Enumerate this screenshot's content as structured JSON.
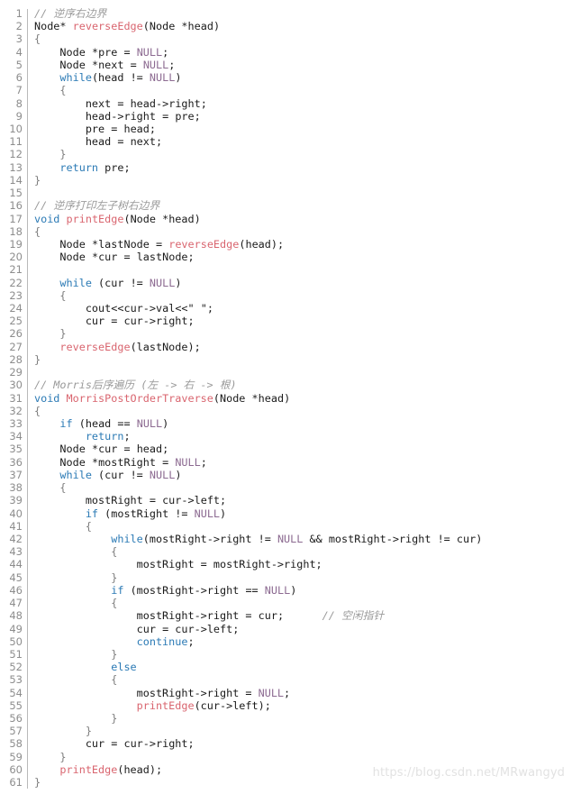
{
  "code_block": {
    "language": "cpp",
    "total_lines": 61,
    "theme": {
      "background": "#ffffff",
      "text": "#1a1a1a",
      "gutter_text": "#8d8d8d",
      "divider": "#b9b9b9",
      "keyword": "#2b7ab5",
      "function": "#d9656f",
      "constant": "#8c6a91",
      "comment": "#9a9a9a",
      "brace": "#7d7d7d",
      "watermark": "#e2e2e2"
    },
    "line_numbers": [
      "1",
      "2",
      "3",
      "4",
      "5",
      "6",
      "7",
      "8",
      "9",
      "10",
      "11",
      "12",
      "13",
      "14",
      "15",
      "16",
      "17",
      "18",
      "19",
      "20",
      "21",
      "22",
      "23",
      "24",
      "25",
      "26",
      "27",
      "28",
      "29",
      "30",
      "31",
      "32",
      "33",
      "34",
      "35",
      "36",
      "37",
      "38",
      "39",
      "40",
      "41",
      "42",
      "43",
      "44",
      "45",
      "46",
      "47",
      "48",
      "49",
      "50",
      "51",
      "52",
      "53",
      "54",
      "55",
      "56",
      "57",
      "58",
      "59",
      "60",
      "61"
    ],
    "lines": [
      "// 逆序右边界",
      "Node* reverseEdge(Node *head)",
      "{",
      "    Node *pre = NULL;",
      "    Node *next = NULL;",
      "    while(head != NULL)",
      "    {",
      "        next = head->right;",
      "        head->right = pre;",
      "        pre = head;",
      "        head = next;",
      "    }",
      "    return pre;",
      "}",
      "",
      "// 逆序打印左子树右边界",
      "void printEdge(Node *head)",
      "{",
      "    Node *lastNode = reverseEdge(head);",
      "    Node *cur = lastNode;",
      "",
      "    while (cur != NULL)",
      "    {",
      "        cout<<cur->val<<\" \";",
      "        cur = cur->right;",
      "    }",
      "    reverseEdge(lastNode);",
      "}",
      "",
      "// Morris后序遍历 (左 -> 右 -> 根)",
      "void MorrisPostOrderTraverse(Node *head)",
      "{",
      "    if (head == NULL)",
      "        return;",
      "    Node *cur = head;",
      "    Node *mostRight = NULL;",
      "    while (cur != NULL)",
      "    {",
      "        mostRight = cur->left;",
      "        if (mostRight != NULL)",
      "        {",
      "            while(mostRight->right != NULL && mostRight->right != cur)",
      "            {",
      "                mostRight = mostRight->right;",
      "            }",
      "            if (mostRight->right == NULL)",
      "            {",
      "                mostRight->right = cur;      // 空闲指针",
      "                cur = cur->left;",
      "                continue;",
      "            }",
      "            else",
      "            {",
      "                mostRight->right = NULL;",
      "                printEdge(cur->left);",
      "            }",
      "        }",
      "        cur = cur->right;",
      "    }",
      "    printEdge(head);",
      "}"
    ]
  },
  "watermark": {
    "text": "https://blog.csdn.net/MRwangyd"
  }
}
